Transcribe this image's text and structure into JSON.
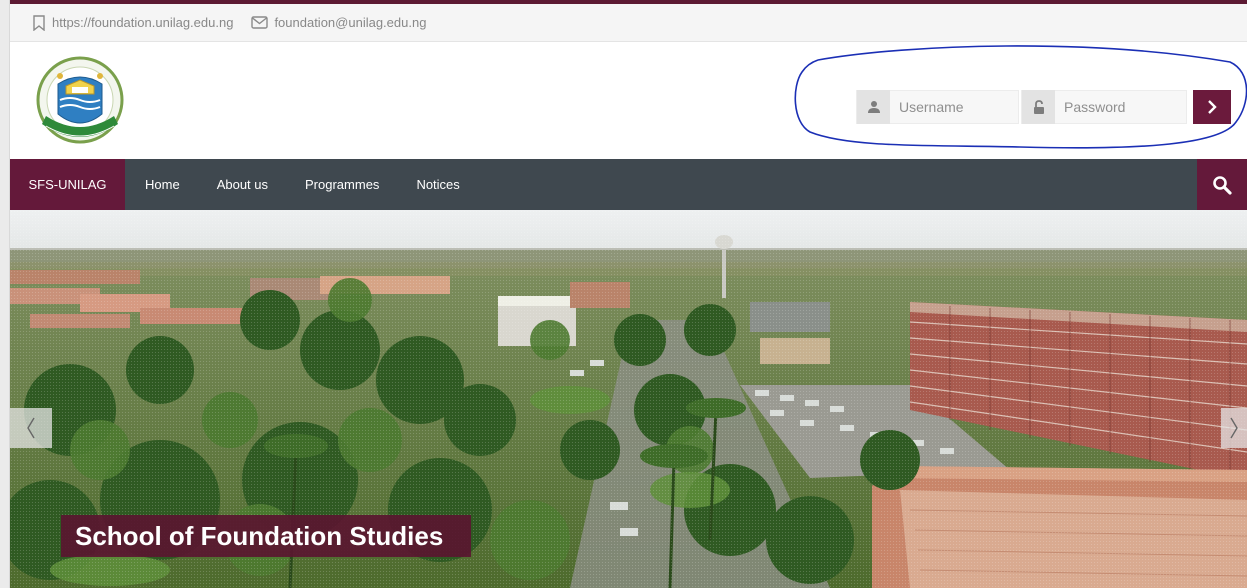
{
  "topbar": {
    "website": "https://foundation.unilag.edu.ng",
    "email": "foundation@unilag.edu.ng"
  },
  "header": {
    "logo_icon": "university-of-lagos-crest-icon"
  },
  "login": {
    "username_placeholder": "Username",
    "password_placeholder": "Password",
    "submit_icon": "chevron-right-icon"
  },
  "navbar": {
    "brand": "SFS-UNILAG",
    "items": [
      "Home",
      "About us",
      "Programmes",
      "Notices"
    ],
    "search_icon": "search-icon"
  },
  "hero": {
    "caption": "School of Foundation Studies",
    "prev_icon": "chevron-left-icon",
    "next_icon": "chevron-right-icon"
  },
  "colors": {
    "brand": "#64193a",
    "navbar": "#3f484f",
    "topbar": "#f5f5f5",
    "annotation": "#1b2fb5"
  }
}
